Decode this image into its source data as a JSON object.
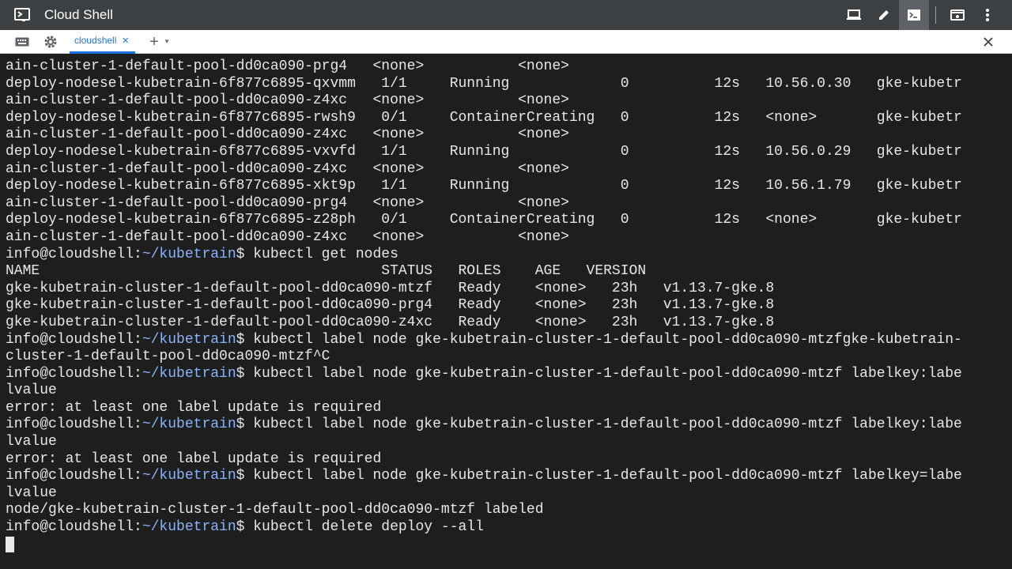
{
  "header": {
    "title": "Cloud Shell",
    "icons": [
      "cloud-shell-logo-icon",
      "laptop-icon",
      "edit-icon",
      "terminal-icon",
      "preview-icon",
      "more-vert-icon"
    ]
  },
  "tabbar": {
    "tab_label": "cloudshell",
    "close_tab_glyph": "×",
    "add_tab_glyph": "+",
    "caret_glyph": "▾"
  },
  "terminal": {
    "lines": [
      "ain-cluster-1-default-pool-dd0ca090-prg4   <none>           <none>",
      "deploy-nodesel-kubetrain-6f877c6895-qxvmm   1/1     Running             0          12s   10.56.0.30   gke-kubetr",
      "ain-cluster-1-default-pool-dd0ca090-z4xc   <none>           <none>",
      "deploy-nodesel-kubetrain-6f877c6895-rwsh9   0/1     ContainerCreating   0          12s   <none>       gke-kubetr",
      "ain-cluster-1-default-pool-dd0ca090-z4xc   <none>           <none>",
      "deploy-nodesel-kubetrain-6f877c6895-vxvfd   1/1     Running             0          12s   10.56.0.29   gke-kubetr",
      "ain-cluster-1-default-pool-dd0ca090-z4xc   <none>           <none>",
      "deploy-nodesel-kubetrain-6f877c6895-xkt9p   1/1     Running             0          12s   10.56.1.79   gke-kubetr",
      "ain-cluster-1-default-pool-dd0ca090-prg4   <none>           <none>",
      "deploy-nodesel-kubetrain-6f877c6895-z28ph   0/1     ContainerCreating   0          12s   <none>       gke-kubetr",
      "ain-cluster-1-default-pool-dd0ca090-z4xc   <none>           <none>",
      {
        "user": "info@cloudshell:",
        "path": "~/kubetrain",
        "rest": "$ kubectl get nodes"
      },
      "NAME                                        STATUS   ROLES    AGE   VERSION",
      "gke-kubetrain-cluster-1-default-pool-dd0ca090-mtzf   Ready    <none>   23h   v1.13.7-gke.8",
      "gke-kubetrain-cluster-1-default-pool-dd0ca090-prg4   Ready    <none>   23h   v1.13.7-gke.8",
      "gke-kubetrain-cluster-1-default-pool-dd0ca090-z4xc   Ready    <none>   23h   v1.13.7-gke.8",
      {
        "user": "info@cloudshell:",
        "path": "~/kubetrain",
        "rest": "$ kubectl label node gke-kubetrain-cluster-1-default-pool-dd0ca090-mtzfgke-kubetrain-"
      },
      "cluster-1-default-pool-dd0ca090-mtzf^C",
      {
        "user": "info@cloudshell:",
        "path": "~/kubetrain",
        "rest": "$ kubectl label node gke-kubetrain-cluster-1-default-pool-dd0ca090-mtzf labelkey:labe"
      },
      "lvalue",
      "error: at least one label update is required",
      {
        "user": "info@cloudshell:",
        "path": "~/kubetrain",
        "rest": "$ kubectl label node gke-kubetrain-cluster-1-default-pool-dd0ca090-mtzf labelkey:labe"
      },
      "lvalue",
      "error: at least one label update is required",
      {
        "user": "info@cloudshell:",
        "path": "~/kubetrain",
        "rest": "$ kubectl label node gke-kubetrain-cluster-1-default-pool-dd0ca090-mtzf labelkey=labe"
      },
      "lvalue",
      "node/gke-kubetrain-cluster-1-default-pool-dd0ca090-mtzf labeled",
      {
        "user": "info@cloudshell:",
        "path": "~/kubetrain",
        "rest": "$ kubectl delete deploy --all"
      }
    ]
  },
  "colors": {
    "header_bg": "#3c4043",
    "terminal_bg": "#1e1e1e",
    "terminal_fg": "#e8e8e8",
    "prompt_path": "#8ab4f8",
    "tab_accent": "#1a73e8"
  }
}
